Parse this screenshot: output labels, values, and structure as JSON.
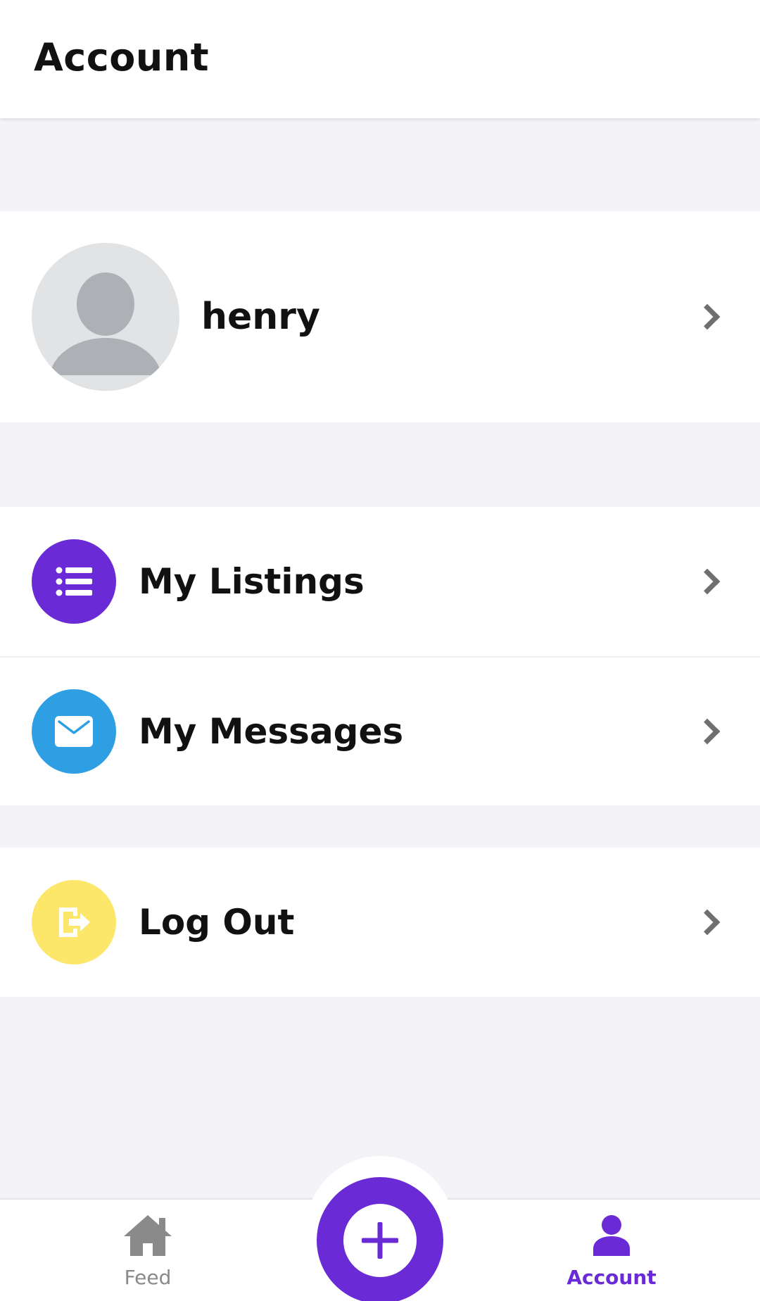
{
  "header": {
    "title": "Account"
  },
  "profile": {
    "name": "henry",
    "avatar_icon": "default-avatar-icon"
  },
  "menu": [
    {
      "label": "My Listings",
      "icon": "list-icon",
      "color": "#6a2bd6"
    },
    {
      "label": "My Messages",
      "icon": "envelope-icon",
      "color": "#2f9fe3"
    },
    {
      "label": "Log Out",
      "icon": "logout-icon",
      "color": "#fde76b"
    }
  ],
  "tabs": {
    "feed": {
      "label": "Feed",
      "icon": "home-icon"
    },
    "add": {
      "icon": "plus-icon"
    },
    "account": {
      "label": "Account",
      "icon": "person-icon",
      "active": true
    }
  },
  "colors": {
    "accent": "#6a2bd6",
    "background": "#f4f3f8"
  }
}
